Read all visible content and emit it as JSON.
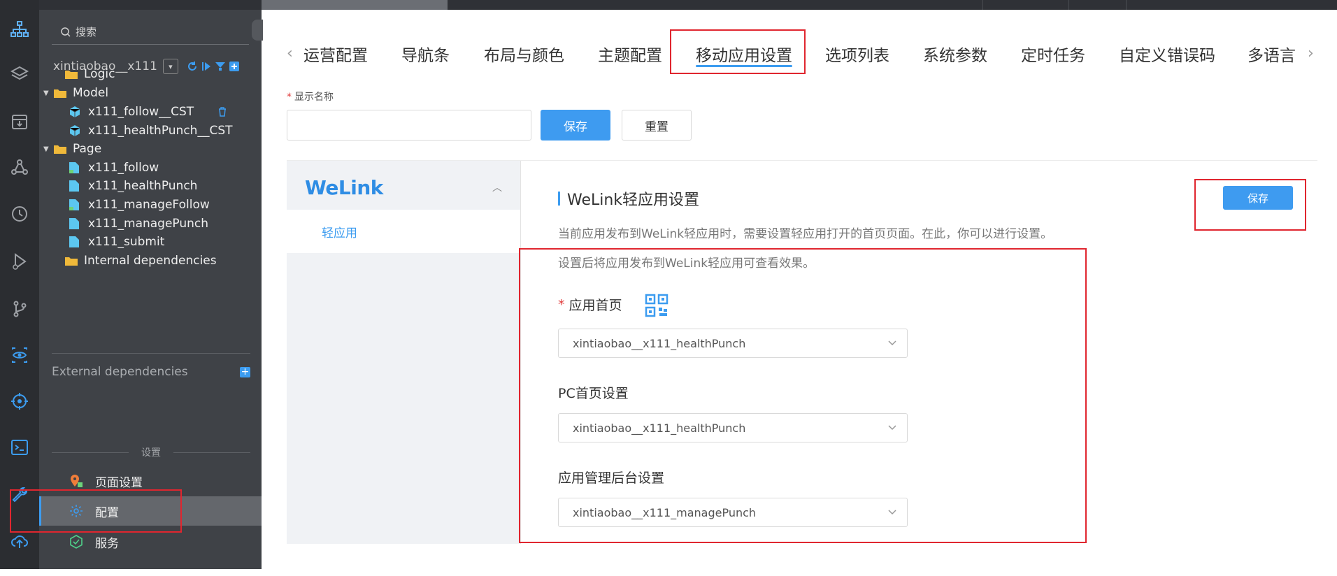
{
  "sidebar": {
    "search_placeholder": "搜索",
    "project_name": "xintiaobao__x111",
    "tree": [
      {
        "label": "Logic"
      },
      {
        "label": "Model"
      },
      {
        "label": "x111_follow__CST"
      },
      {
        "label": "x111_healthPunch__CST"
      },
      {
        "label": "Page"
      },
      {
        "label": "x111_follow"
      },
      {
        "label": "x111_healthPunch"
      },
      {
        "label": "x111_manageFollow"
      },
      {
        "label": "x111_managePunch"
      },
      {
        "label": "x111_submit"
      },
      {
        "label": "Internal dependencies"
      }
    ],
    "external_dependencies": "External dependencies",
    "settings_header": "设置",
    "menu": [
      {
        "label": "页面设置"
      },
      {
        "label": "配置"
      },
      {
        "label": "服务"
      }
    ]
  },
  "tabs": {
    "items": [
      {
        "label": "运营配置"
      },
      {
        "label": "导航条"
      },
      {
        "label": "布局与颜色"
      },
      {
        "label": "主题配置"
      },
      {
        "label": "移动应用设置"
      },
      {
        "label": "选项列表"
      },
      {
        "label": "系统参数"
      },
      {
        "label": "定时任务"
      },
      {
        "label": "自定义错误码"
      },
      {
        "label": "多语言"
      }
    ],
    "active_index": 4
  },
  "display_name": {
    "label": "显示名称",
    "value": "",
    "save": "保存",
    "reset": "重置"
  },
  "welink": {
    "brand": "WeLink",
    "sub_item": "轻应用",
    "section_title": "WeLink轻应用设置",
    "save": "保存",
    "desc1": "当前应用发布到WeLink轻应用时，需要设置轻应用打开的首页页面。在此，你可以进行设置。",
    "desc2": "设置后将应用发布到WeLink轻应用可查看效果。",
    "home_label": "应用首页",
    "home_value": "xintiaobao__x111_healthPunch",
    "pc_label": "PC首页设置",
    "pc_value": "xintiaobao__x111_healthPunch",
    "admin_label": "应用管理后台设置",
    "admin_value": "xintiaobao__x111_managePunch"
  },
  "colors": {
    "accent": "#3e9bf0",
    "highlight_box": "#e0262f",
    "sidebar_bg": "#3f4247",
    "rail_bg": "#2b2d31"
  }
}
